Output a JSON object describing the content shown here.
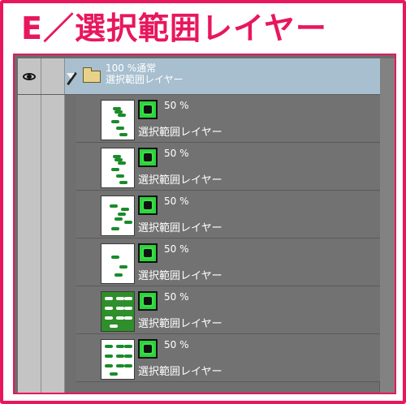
{
  "title": "E／選択範囲レイヤー",
  "folder": {
    "opacity_mode": "100 %通常",
    "name": "選択範囲レイヤー"
  },
  "layers": [
    {
      "opacity": "50 %",
      "name": "選択範囲レイヤー",
      "thumb": "sparse-vertical"
    },
    {
      "opacity": "50 %",
      "name": "選択範囲レイヤー",
      "thumb": "sparse-vertical"
    },
    {
      "opacity": "50 %",
      "name": "選択範囲レイヤー",
      "thumb": "dots"
    },
    {
      "opacity": "50 %",
      "name": "選択範囲レイヤー",
      "thumb": "faint-dots"
    },
    {
      "opacity": "50 %",
      "name": "選択範囲レイヤー",
      "thumb": "dark-grid"
    },
    {
      "opacity": "50 %",
      "name": "選択範囲レイヤー",
      "thumb": "grid"
    }
  ],
  "colors": {
    "accent": "#e8175d",
    "folder_row": "#a8bfd0",
    "panel": "#6f6f6f",
    "mask_green": "#2cd43c"
  },
  "icons": [
    "eye-icon",
    "pen-icon",
    "expand-icon",
    "folder-icon",
    "mask-icon"
  ]
}
